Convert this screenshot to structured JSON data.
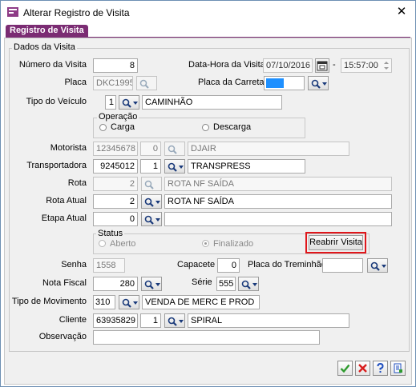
{
  "window": {
    "title": "Alterar Registro de Visita",
    "close_glyph": "✕"
  },
  "tab": {
    "label": "Registro de Visita"
  },
  "section": {
    "title": "Dados da Visita"
  },
  "fields": {
    "numero_visita": {
      "label": "Número da Visita",
      "value": "8"
    },
    "data_hora": {
      "label": "Data-Hora da Visita",
      "date": "07/10/2016",
      "separator": "-",
      "time": "15:57:00"
    },
    "placa": {
      "label": "Placa",
      "value": "DKC1995"
    },
    "placa_carreta": {
      "label": "Placa da Carreta",
      "value": ""
    },
    "tipo_veiculo": {
      "label": "Tipo do Veículo",
      "code": "1",
      "description": "CAMINHÃO"
    },
    "operacao": {
      "title": "Operação",
      "options": [
        "Carga",
        "Descarga"
      ]
    },
    "motorista": {
      "label": "Motorista",
      "code": "12345678",
      "seq": "0",
      "name": "DJAIR"
    },
    "transportadora": {
      "label": "Transportadora",
      "code": "9245012",
      "seq": "1",
      "name": "TRANSPRESS"
    },
    "rota": {
      "label": "Rota",
      "code": "2",
      "name": "ROTA NF SAÍDA"
    },
    "rota_atual": {
      "label": "Rota Atual",
      "code": "2",
      "name": "ROTA NF SAÍDA"
    },
    "etapa_atual": {
      "label": "Etapa Atual",
      "code": "0",
      "name": ""
    },
    "status": {
      "title": "Status",
      "options": [
        "Aberto",
        "Finalizado"
      ],
      "selected": "Finalizado",
      "reopen_button": "Reabrir Visita"
    },
    "senha": {
      "label": "Senha",
      "value": "1558"
    },
    "capacete": {
      "label": "Capacete",
      "value": "0"
    },
    "placa_treminhao": {
      "label": "Placa do Treminhão",
      "value": ""
    },
    "nota_fiscal": {
      "label": "Nota Fiscal",
      "value": "280"
    },
    "serie": {
      "label": "Série",
      "value": "555"
    },
    "tipo_movimento": {
      "label": "Tipo de Movimento",
      "code": "310",
      "description": "VENDA DE MERC E PROD"
    },
    "cliente": {
      "label": "Cliente",
      "code": "63935829",
      "seq": "1",
      "name": "SPIRAL"
    },
    "observacao": {
      "label": "Observação",
      "value": ""
    }
  },
  "colors": {
    "tab": "#7b2c73",
    "highlight_border": "#e0161b",
    "placa_carreta_fill": "#1e90ff",
    "ok": "#2e9b2e",
    "cancel": "#d81e1e",
    "help": "#1f4fbf"
  },
  "icons": [
    "app-icon",
    "search-icon",
    "dropdown-arrow-icon",
    "calendar-icon",
    "spinner-icon",
    "ok-check-icon",
    "cancel-x-icon",
    "help-icon",
    "print-icon"
  ]
}
